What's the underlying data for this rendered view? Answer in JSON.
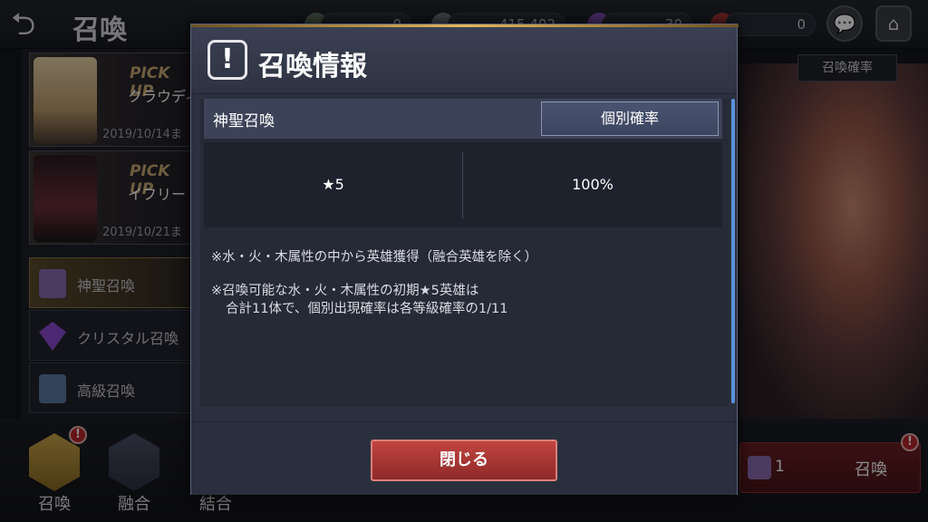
{
  "screen": {
    "title": "召喚",
    "back_icon": "back-arrow-icon"
  },
  "top_bar": {
    "currency_1": "0",
    "currency_2": "415,402",
    "currency_3": "30",
    "currency_4": "0"
  },
  "left_panel": {
    "banners": [
      {
        "pick": "PICK UP",
        "name": "クラウディ",
        "date": "2019/10/14ま"
      },
      {
        "pick": "PICK UP",
        "name": "イフリー",
        "date": "2019/10/21ま"
      }
    ],
    "menu": [
      {
        "label": "神聖召喚"
      },
      {
        "label": "クリスタル召喚"
      },
      {
        "label": "高級召喚"
      }
    ]
  },
  "right_panel": {
    "prob_button": "召喚確率",
    "summon_count": "1",
    "summon_label": "召喚"
  },
  "bottom_tabs": [
    {
      "label": "召喚"
    },
    {
      "label": "融合"
    },
    {
      "label": "結合"
    }
  ],
  "modal": {
    "title": "召喚情報",
    "category": "神聖召喚",
    "individual_tab": "個別確率",
    "table": {
      "rarity": "★5",
      "rate": "100%"
    },
    "notes": {
      "note1": "※水・火・木属性の中から英雄獲得（融合英雄を除く）",
      "note2_line1": "※召喚可能な水・火・木属性の初期★5英雄は",
      "note2_line2": "合計11体で、個別出現確率は各等級確率の1/11"
    },
    "close_button": "閉じる"
  },
  "colors": {
    "modal_bg": "#2b3040",
    "accent_gold": "#e2b65a",
    "close_red": "#b23a36",
    "scroll_blue": "#5a90d8"
  }
}
